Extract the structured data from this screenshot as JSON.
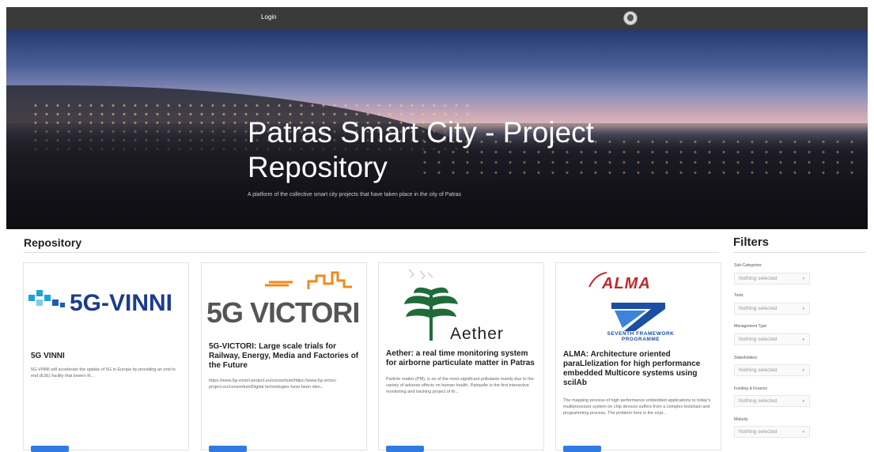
{
  "topbar": {
    "login_label": "Login"
  },
  "hero": {
    "title": "Patras Smart City - Project Repository",
    "subtitle": "A platform of the collective smart city projects that have taken place in the city of Patras"
  },
  "repository": {
    "heading": "Repository"
  },
  "cards": [
    {
      "logo_text": "5G-VINNI",
      "title": "5G VINNI",
      "description": "5G-VINNI will accelerate the uptake of 5G in Europe by providing an end to end (E2E) facility that lowers th..."
    },
    {
      "logo_text": "5G VICTORI",
      "title": "5G-VICTORI: Large scale trials for Railway, Energy, Media and Factories of the Future",
      "description": "https://www.5g-victori-project.eu/consortium/https://www.5g-victori-project.eu/consortium/Digital technologies have been iden..."
    },
    {
      "logo_text": "Aether",
      "title": "Aether: a real time monitoring system for airborne particulate matter in Patras",
      "description": "Particle matter (PM), is on of the most significant pollutants mainly due to the variety of adverse effects on human health. PatrasAir is the first interactive monitoring and tracking project of th..."
    },
    {
      "logo_text": "ALMA",
      "logo_text_2": "SEVENTH FRAMEWORK PROGRAMME",
      "title": "ALMA: Architecture oriented paraLlelization for high performance embedded Multicore systems using scilAb",
      "description": "The mapping process of high performance embedded applications to today's multiprocessor system on chip devices suffers from a complex toolchain and programming process. The problem here is the expr..."
    }
  ],
  "filters": {
    "heading": "Filters",
    "items": [
      {
        "label": "Sub-Categories",
        "placeholder": "Nothing selected"
      },
      {
        "label": "Tools",
        "placeholder": "Nothing selected"
      },
      {
        "label": "Management Type",
        "placeholder": "Nothing selected"
      },
      {
        "label": "Stakeholders",
        "placeholder": "Nothing selected"
      },
      {
        "label": "Funding & Finance",
        "placeholder": "Nothing selected"
      },
      {
        "label": "Maturity",
        "placeholder": "Nothing selected"
      }
    ],
    "caret": "▾"
  }
}
